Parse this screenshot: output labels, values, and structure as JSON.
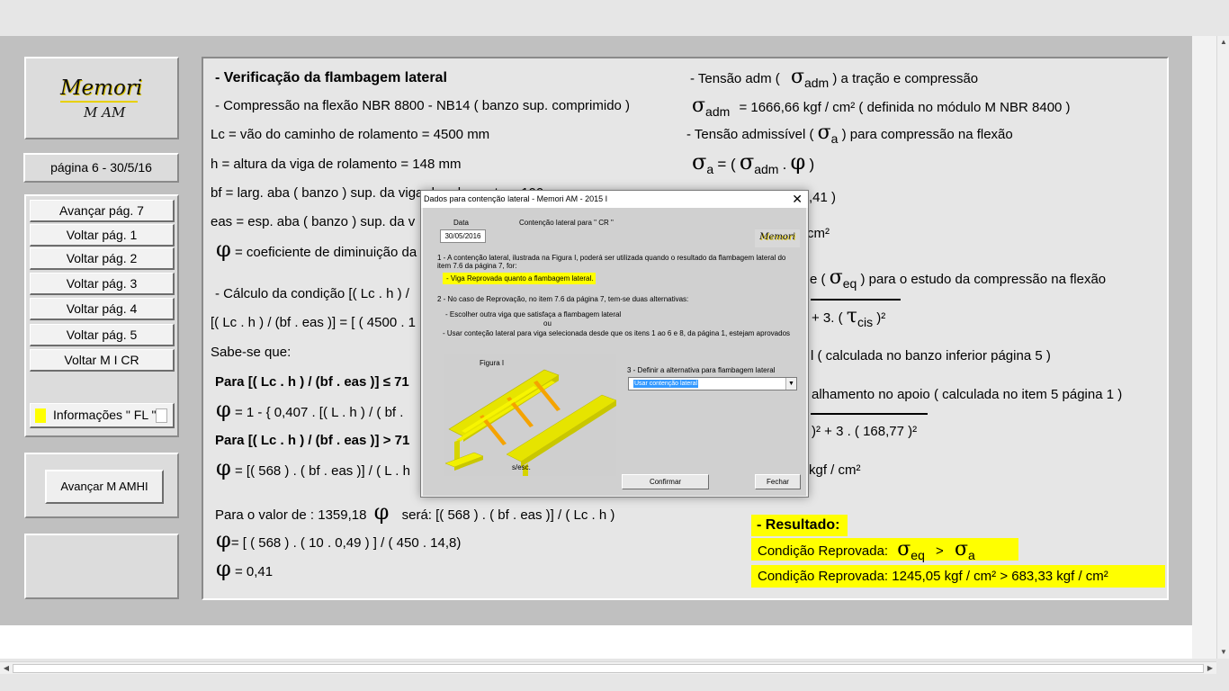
{
  "left_panel": {
    "logo_main": "Memori",
    "logo_sub": "M AM",
    "page_info": "página 6 -   30/5/16",
    "nav_buttons": [
      "Avançar pág. 7",
      "Voltar pág. 1",
      "Voltar pág. 2",
      "Voltar pág. 3",
      "Voltar pág. 4",
      "Voltar pág. 5",
      "Voltar  M I CR"
    ],
    "info_button": "Informações  \" FL \"",
    "mamhi_button": "Avançar M AMHI"
  },
  "main": {
    "title": "- Verificação da flambagem lateral",
    "l1": "- Compressão na flexão NBR 8800 - NB14 ( banzo sup. comprimido )",
    "l2": "Lc = vão do caminho de rolamento = 4500 mm",
    "l3": "h = altura da viga de rolamento = 148 mm",
    "l4": "bf = larg. aba ( banzo ) sup. da viga de rolamento = 100 mm",
    "l5": "eas = esp. aba ( banzo ) sup. da v",
    "l6_sym": "φ",
    "l6": "= coeficiente de diminuição da",
    "l7": "- Cálculo da condição   [( Lc . h ) /",
    "l8": "[( Lc . h ) / (bf . eas )] = [ ( 4500 . 1",
    "l9": "Sabe-se que:",
    "l10": "Para  [( Lc . h ) / (bf . eas )] ≤ 71",
    "l11_sym": "φ",
    "l11": "=  1 - { 0,407 . [( L . h ) / ( bf .",
    "l12": "Para  [( Lc . h ) / (bf . eas )] > 71",
    "l13_sym": "φ",
    "l13": "= [( 568 ) . ( bf . eas )] / ( L . h",
    "l14a": "Para  o valor de :  1359,18",
    "l14_sym": "φ",
    "l14b": "será:  [( 568 ) . ( bf . eas )] / ( Lc . h )",
    "l15_sym": "φ",
    "l15": "= [ ( 568 ) . ( 10 . 0,49 ) ] / ( 450 . 14,8)",
    "l16_sym": "φ",
    "l16": "= 0,41"
  },
  "right": {
    "r1a": "- Tensão adm (",
    "r1_sym": "σ",
    "r1_sub": "adm",
    "r1b": ") a tração e compressão",
    "r2_sym": "σ",
    "r2_sub": "adm",
    "r2": "= 1666,66 kgf / cm²  ( definida no módulo M NBR 8400 )",
    "r3a": "- Tensão admissível (",
    "r3_sym": "σ",
    "r3_sub": "a",
    "r3b": ") para compressão na flexão",
    "r4_sym": "σ",
    "r4_sub": "a",
    "r4a": "= (",
    "r4_sym2": "σ",
    "r4_sub2": "adm",
    "r4b": ".",
    "r4_sym3": "φ",
    "r4c": ")",
    "r5": ",41 )",
    "r6": "cm²",
    "r7a": "e (",
    "r7_sym": "σ",
    "r7_sub": "eq",
    "r7b": ") para o estudo da compressão na flexão",
    "r8a": "+ 3. (",
    "r8_sym": "τ",
    "r8_sub": "cis",
    "r8b": ")²",
    "r9": "l ( calculada no banzo inferior página 5 )",
    "r10": "alhamento no apoio ( calculada no item 5 página 1 )",
    "r11": ")² + 3 . ( 168,77 )²",
    "r12": "kgf / cm²",
    "result_title": "- Resultado:",
    "result1a": "Condição Reprovada:",
    "result1_sym": "σ",
    "result1_sub": "eq",
    "result1_gt": ">",
    "result1_sym2": "σ",
    "result1_sub2": "a",
    "result2": "Condição Reprovada: 1245,05 kgf / cm²  >  683,33 kgf / cm²"
  },
  "dialog": {
    "title": "Dados para contenção lateral - Memori AM - 2015 I",
    "close": "✕",
    "data_label": "Data",
    "data_value": "30/05/2016",
    "contencao_label": "Contenção lateral para \" CR \"",
    "logo": "Memori",
    "p1": "1 - A contenção lateral, ilustrada na Figura I, poderá ser utilizada quando o resultado da flambagem lateral do",
    "p1b": "item 7.6 da página 7, for:",
    "p1_highlight": "- Viga Reprovada quanto a flambagem lateral.",
    "p2": "2 -  No caso de Reprovação, no item 7.6 da página 7, tem-se duas alternativas:",
    "p2a": "- Escolher outra viga que satisfaça a flambagem lateral",
    "p2_ou": "ou",
    "p2b": "- Usar conteção lateral para viga selecionada desde que os itens 1 ao 6 e 8, da página 1, estejam aprovados",
    "fig_label": "Figura I",
    "fig_scale": "s/esc.",
    "p3": "3 - Definir a alternativa para flambagem lateral",
    "select_value": "Usar contenção lateral",
    "confirm": "Confirmar",
    "close_btn": "Fechar"
  },
  "colors": {
    "highlight": "#ffff00",
    "beam": "#f2f000",
    "brace": "#f5a300",
    "selection": "#3399ff"
  }
}
